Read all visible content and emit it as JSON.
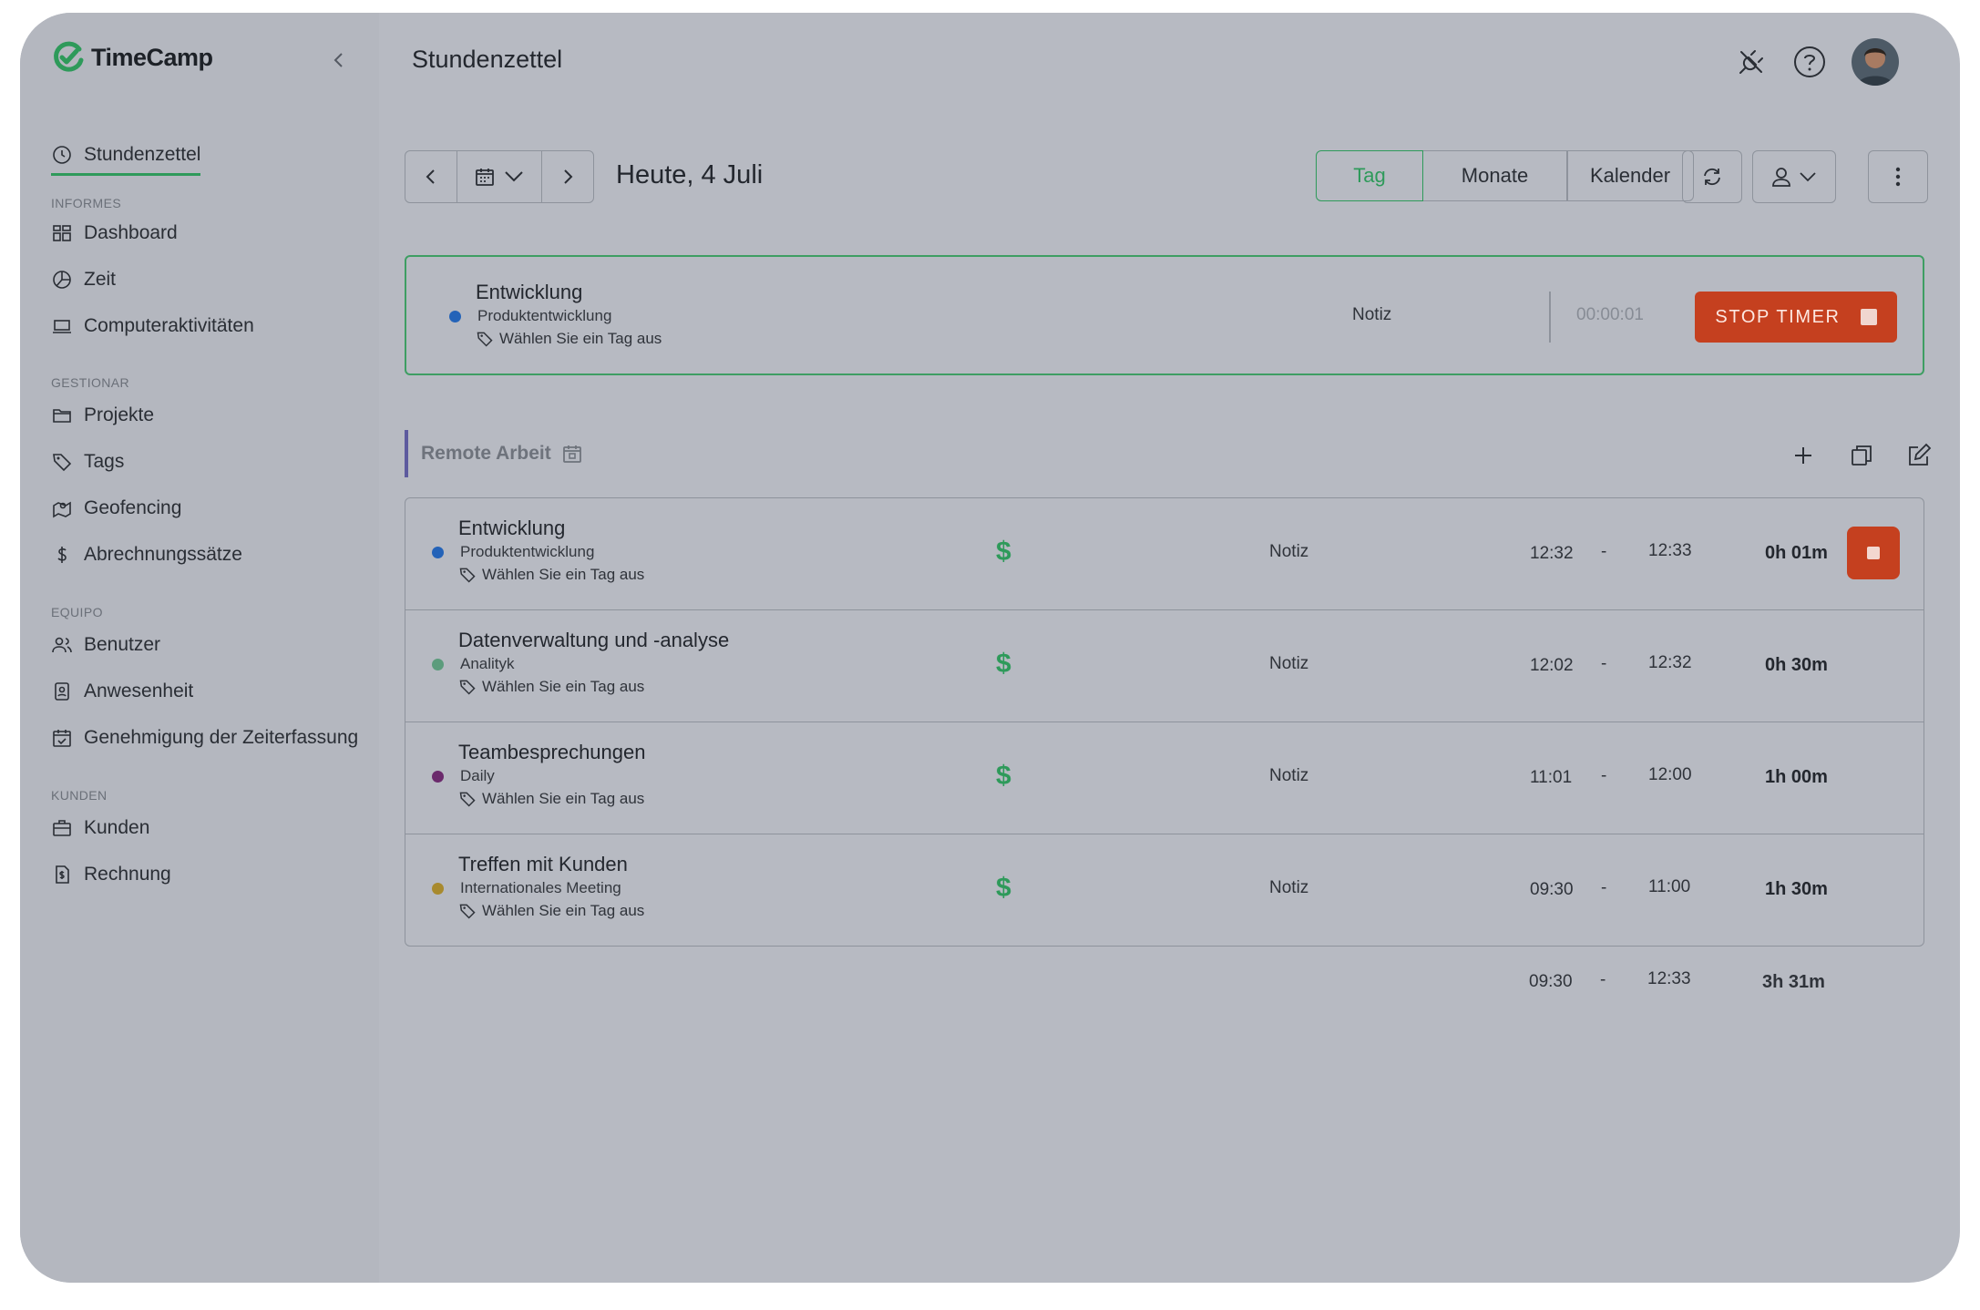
{
  "app": {
    "name": "TimeCamp"
  },
  "sidebar": {
    "active": {
      "label": "Stundenzettel"
    },
    "sections": [
      {
        "label": "INFORMES",
        "items": [
          {
            "label": "Dashboard"
          },
          {
            "label": "Zeit"
          },
          {
            "label": "Computeraktivitäten"
          }
        ]
      },
      {
        "label": "GESTIONAR",
        "items": [
          {
            "label": "Projekte"
          },
          {
            "label": "Tags"
          },
          {
            "label": "Geofencing"
          },
          {
            "label": "Abrechnungssätze"
          }
        ]
      },
      {
        "label": "EQUIPO",
        "items": [
          {
            "label": "Benutzer"
          },
          {
            "label": "Anwesenheit"
          },
          {
            "label": "Genehmigung der Zeiterfassung"
          }
        ]
      },
      {
        "label": "KUNDEN",
        "items": [
          {
            "label": "Kunden"
          },
          {
            "label": "Rechnung"
          }
        ]
      }
    ]
  },
  "header": {
    "title": "Stundenzettel"
  },
  "toolbar": {
    "date_label": "Heute, 4 Juli",
    "views": [
      {
        "label": "Tag"
      },
      {
        "label": "Monate"
      },
      {
        "label": "Kalender"
      }
    ]
  },
  "timer": {
    "title": "Entwicklung",
    "subtitle": "Produktentwicklung",
    "tag": "Wählen Sie ein Tag aus",
    "note": "Notiz",
    "elapsed": "00:00:01",
    "stop_label": "STOP TIMER",
    "dot_color": "#2463b8"
  },
  "group": {
    "name": "Remote Arbeit"
  },
  "entries": [
    {
      "title": "Entwicklung",
      "subtitle": "Produktentwicklung",
      "tag": "Wählen Sie ein Tag aus",
      "billable": "$",
      "note": "Notiz",
      "start": "12:32",
      "sep": "-",
      "end": "12:33",
      "duration": "0h 01m",
      "dot_color": "#2463b8"
    },
    {
      "title": "Datenverwaltung und -analyse",
      "subtitle": "Analityk",
      "tag": "Wählen Sie ein Tag aus",
      "billable": "$",
      "note": "Notiz",
      "start": "12:02",
      "sep": "-",
      "end": "12:32",
      "duration": "0h 30m",
      "dot_color": "#5c9c7c"
    },
    {
      "title": "Teambesprechungen",
      "subtitle": "Daily",
      "tag": "Wählen Sie ein Tag aus",
      "billable": "$",
      "note": "Notiz",
      "start": "11:01",
      "sep": "-",
      "end": "12:00",
      "duration": "1h 00m",
      "dot_color": "#6b2a6c"
    },
    {
      "title": "Treffen mit Kunden",
      "subtitle": "Internationales Meeting",
      "tag": "Wählen Sie ein Tag aus",
      "billable": "$",
      "note": "Notiz",
      "start": "09:30",
      "sep": "-",
      "end": "11:00",
      "duration": "1h 30m",
      "dot_color": "#a88a2e"
    }
  ],
  "totals": {
    "start": "09:30",
    "sep": "-",
    "end": "12:33",
    "duration": "3h 31m"
  },
  "colors": {
    "accent": "#2e9a5a",
    "stop": "#c5401f",
    "group_bar": "#5d5a9e"
  }
}
